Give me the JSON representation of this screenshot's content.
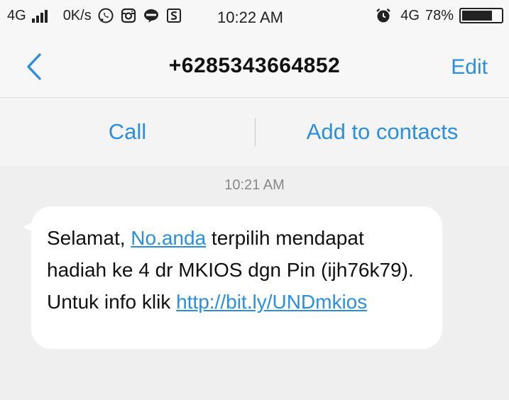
{
  "status_bar": {
    "network_left": "4G",
    "speed": "0K/s",
    "time": "10:22 AM",
    "network_right": "4G",
    "battery": "78%",
    "battery_level": 0.78
  },
  "header": {
    "title": "+6285343664852",
    "edit_label": "Edit"
  },
  "actions": {
    "call_label": "Call",
    "add_label": "Add to contacts"
  },
  "message": {
    "time": "10:21 AM",
    "part1": "Selamat, ",
    "link1": "No.anda",
    "part2": " terpilih mendapat hadiah ke 4 dr MKIOS dgn Pin (ijh76k79). Untuk info klik ",
    "link2": "http://bit.ly/UNDmkios"
  },
  "colors": {
    "accent": "#2a8fe0",
    "background": "#efefef",
    "bubble": "#ffffff"
  },
  "icons": [
    "signal-icon",
    "whatsapp-icon",
    "instagram-icon",
    "line-icon",
    "s-app-icon",
    "alarm-icon",
    "battery-icon",
    "back-chevron-icon"
  ]
}
